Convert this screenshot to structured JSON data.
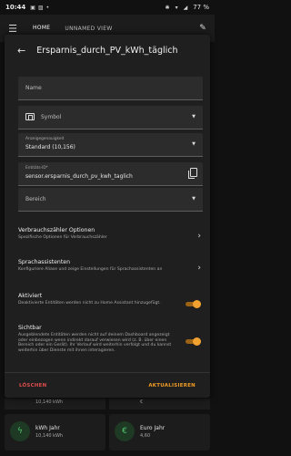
{
  "status_bar": {
    "time": "10:44",
    "battery": "77 %"
  },
  "app_bar": {
    "tabs": [
      "HOME",
      "UNNAMED VIEW"
    ]
  },
  "dialog": {
    "title": "Ersparnis_durch_PV_kWh_täglich",
    "name_placeholder": "Name",
    "symbol_placeholder": "Symbol",
    "precision_label": "Anzeigegenauigkeit",
    "precision_value": "Standard (10,156)",
    "entity_id_label": "Entitäts-ID*",
    "entity_id_value": "sensor.ersparnis_durch_pv_kwh_taglich",
    "area_placeholder": "Bereich",
    "rows": [
      {
        "title": "Verbrauchszähler Optionen",
        "sub": "Spezifische Optionen für Verbrauchszähler"
      },
      {
        "title": "Sprachassistenten",
        "sub": "Konfiguriere Aliase und zeige Einstellungen für Sprachassistenten an"
      },
      {
        "title": "Aktiviert",
        "sub": "Deaktivierte Entitäten werden nicht zu Home Assistant hinzugefügt."
      },
      {
        "title": "Sichtbar",
        "sub": "Ausgeblendete Entitäten werden nicht auf deinem Dashboard angezeigt oder einbezogen wenn indirekt darauf verwiesen wird (z. B. über einen Bereich oder ein Gerät). Ihr Verlauf wird weiterhin verfolgt und du kannst weiterhin über Dienste mit ihnen interagieren."
      }
    ],
    "toggles": {
      "aktiviert": true,
      "sichtbar": true
    },
    "delete_label": "LÖSCHEN",
    "update_label": "AKTUALISIEREN"
  },
  "background_cards": {
    "peek_left": "10,140 kWh",
    "peek_right": "€",
    "cards": [
      {
        "name": "kWh Jahr",
        "value": "10,140 kWh",
        "icon": "lightning-icon"
      },
      {
        "name": "Euro Jahr",
        "value": "4,60",
        "icon": "euro-icon"
      }
    ]
  },
  "colors": {
    "accent": "#f19c24",
    "danger": "#e24d4d",
    "icon_green": "#4ec06b"
  }
}
